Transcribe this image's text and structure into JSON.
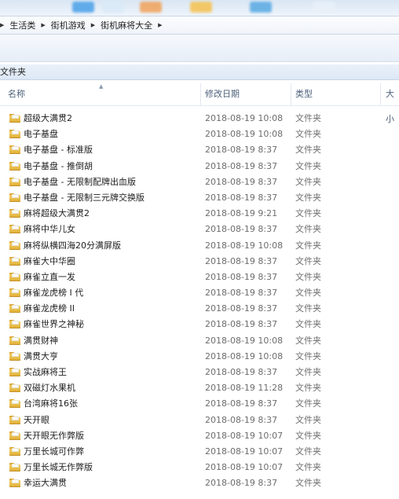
{
  "breadcrumb": {
    "items": [
      "生活类",
      "街机游戏",
      "街机麻将大全"
    ]
  },
  "navigation_pane": {
    "label": "文件夹"
  },
  "columns": {
    "name": "名称",
    "date": "修改日期",
    "type": "类型",
    "size": "大小"
  },
  "files": [
    {
      "name": "超级大满贯2",
      "date": "2018-08-19 10:08",
      "type": "文件夹"
    },
    {
      "name": "电子基盘",
      "date": "2018-08-19 10:08",
      "type": "文件夹"
    },
    {
      "name": "电子基盘 - 标准版",
      "date": "2018-08-19 8:37",
      "type": "文件夹"
    },
    {
      "name": "电子基盘 - 推倒胡",
      "date": "2018-08-19 8:37",
      "type": "文件夹"
    },
    {
      "name": "电子基盘 - 无限制配牌出血版",
      "date": "2018-08-19 8:37",
      "type": "文件夹"
    },
    {
      "name": "电子基盘 - 无限制三元牌交换版",
      "date": "2018-08-19 8:37",
      "type": "文件夹"
    },
    {
      "name": "麻将超级大满贯2",
      "date": "2018-08-19 9:21",
      "type": "文件夹"
    },
    {
      "name": "麻将中华儿女",
      "date": "2018-08-19 8:37",
      "type": "文件夹"
    },
    {
      "name": "麻将纵横四海20分满屏版",
      "date": "2018-08-19 10:08",
      "type": "文件夹"
    },
    {
      "name": "麻雀大中华圈",
      "date": "2018-08-19 8:37",
      "type": "文件夹"
    },
    {
      "name": "麻雀立直一发",
      "date": "2018-08-19 8:37",
      "type": "文件夹"
    },
    {
      "name": "麻雀龙虎榜 I 代",
      "date": "2018-08-19 8:37",
      "type": "文件夹"
    },
    {
      "name": "麻雀龙虎榜 II",
      "date": "2018-08-19 8:37",
      "type": "文件夹"
    },
    {
      "name": "麻雀世界之神秘",
      "date": "2018-08-19 8:37",
      "type": "文件夹"
    },
    {
      "name": "满贯财神",
      "date": "2018-08-19 10:08",
      "type": "文件夹"
    },
    {
      "name": "满贯大亨",
      "date": "2018-08-19 10:08",
      "type": "文件夹"
    },
    {
      "name": "实战麻将王",
      "date": "2018-08-19 8:37",
      "type": "文件夹"
    },
    {
      "name": "双磁灯水果机",
      "date": "2018-08-19 11:28",
      "type": "文件夹"
    },
    {
      "name": "台湾麻将16张",
      "date": "2018-08-19 8:37",
      "type": "文件夹"
    },
    {
      "name": "天开眼",
      "date": "2018-08-19 8:37",
      "type": "文件夹"
    },
    {
      "name": "天开眼无作弊版",
      "date": "2018-08-19 10:07",
      "type": "文件夹"
    },
    {
      "name": "万里长城可作弊",
      "date": "2018-08-19 10:07",
      "type": "文件夹"
    },
    {
      "name": "万里长城无作弊版",
      "date": "2018-08-19 10:07",
      "type": "文件夹"
    },
    {
      "name": "幸运大满贯",
      "date": "2018-08-19 8:37",
      "type": "文件夹"
    }
  ],
  "icons": {
    "folder": "folder-icon",
    "breadcrumb_separator": "chevron-right-icon",
    "sort": "sort-ascending-icon"
  },
  "colors": {
    "folder": "#e7b94a",
    "header_text": "#4c607a",
    "secondary_text": "#6d6d6d"
  }
}
